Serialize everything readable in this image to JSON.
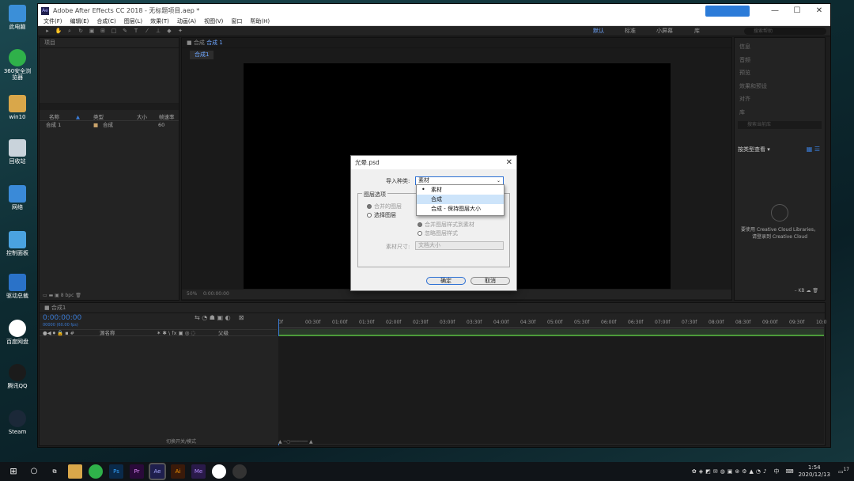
{
  "window": {
    "title": "Adobe After Effects CC 2018 - 无标题项目.aep *",
    "app_badge": "Ae",
    "min": "—",
    "max": "☐",
    "close": "✕"
  },
  "menu": [
    "文件(F)",
    "编辑(E)",
    "合成(C)",
    "图层(L)",
    "效果(T)",
    "动画(A)",
    "视图(V)",
    "窗口",
    "帮助(H)"
  ],
  "workspaces": {
    "default": "默认",
    "standard": "标准",
    "small": "小屏幕",
    "lib": "库"
  },
  "search_help": "搜索帮助",
  "project": {
    "title": "项目",
    "cols": [
      "名称",
      "类型",
      "大小",
      "帧速率"
    ],
    "item": {
      "name": "合成 1",
      "type": "合成",
      "fps": "60"
    },
    "bpc": "8 bpc"
  },
  "comp": {
    "title": "合成",
    "name": "合成 1",
    "tab": "合成1",
    "zoom": "50%",
    "time": "0:00:00:00"
  },
  "right": {
    "items": [
      "信息",
      "音频",
      "预览",
      "效果和预设",
      "对齐",
      "库"
    ],
    "search_ph": "搜索当前库",
    "view_by": "按类型查看",
    "cc_line1": "要使用 Creative Cloud Libraries，",
    "cc_line2": "请登录到 Creative Cloud",
    "kb": "– KB"
  },
  "timeline": {
    "tab": "合成1",
    "timecode": "0:00:00:00",
    "fps_sub": "00000 (60.00 fps)",
    "col_src": "源名称",
    "col_parent": "父级",
    "switches": "切换开关/模式",
    "ticks": [
      "0f",
      "00:30f",
      "01:00f",
      "01:30f",
      "02:00f",
      "02:30f",
      "03:00f",
      "03:30f",
      "04:00f",
      "04:30f",
      "05:00f",
      "05:30f",
      "06:00f",
      "06:30f",
      "07:00f",
      "07:30f",
      "08:00f",
      "08:30f",
      "09:00f",
      "09:30f",
      "10:0"
    ]
  },
  "dialog": {
    "title": "光晕.psd",
    "import_label": "导入种类:",
    "import_value": "素材",
    "layer_opts": "图层选项",
    "merged": "合并的图层",
    "choose": "选择图层",
    "merge_styles": "合并图层样式到素材",
    "ignore_styles": "忽略图层样式",
    "footage_size": "素材尺寸:",
    "footage_size_value": "文档大小",
    "ok": "确定",
    "cancel": "取消"
  },
  "dropdown": [
    "素材",
    "合成",
    "合成 - 保持图层大小"
  ],
  "desktop": [
    "此电脑",
    "360安全浏览器",
    "win10",
    "回收站",
    "网络",
    "控制面板",
    "驱动总裁",
    "百度网盘",
    "腾讯QQ",
    "Steam"
  ],
  "taskbar": {
    "time": "1:54",
    "date": "2020/12/13",
    "ime": "中",
    "notif": "17"
  },
  "colors": {
    "accent": "#2b6fd4",
    "ae_blue": "#3a7bd5",
    "timeline_green": "#4c9b3a"
  }
}
